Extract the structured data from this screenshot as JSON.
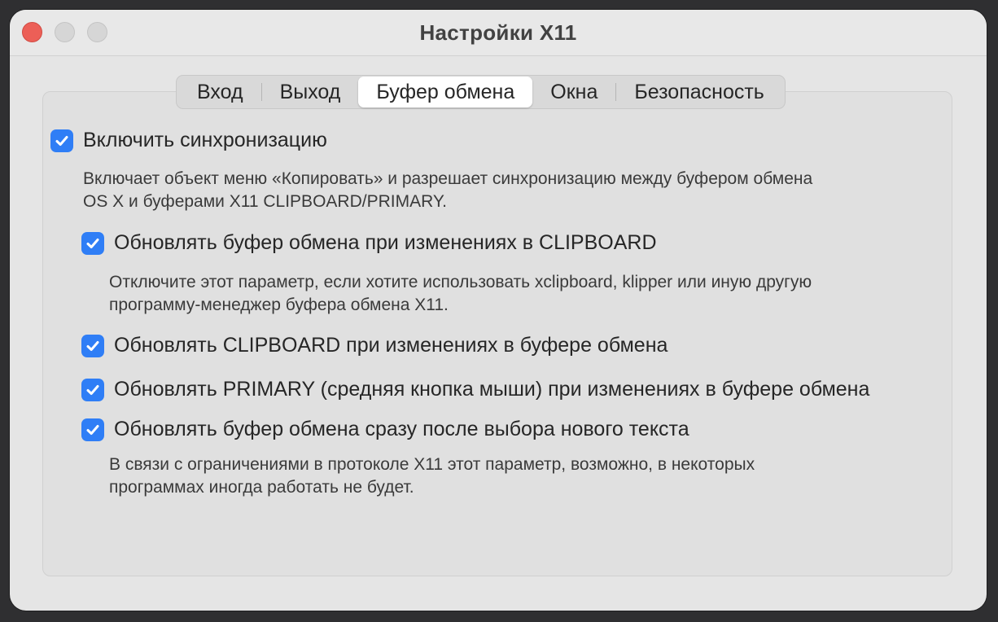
{
  "window": {
    "title": "Настройки X11"
  },
  "tabs": [
    {
      "label": "Вход",
      "active": false
    },
    {
      "label": "Выход",
      "active": false
    },
    {
      "label": "Буфер обмена",
      "active": true
    },
    {
      "label": "Окна",
      "active": false
    },
    {
      "label": "Безопасность",
      "active": false
    }
  ],
  "options": {
    "enable_sync": {
      "label": "Включить синхронизацию",
      "checked": true,
      "description_line1": "Включает объект меню «Копировать» и разрешает синхронизацию между буфером обмена",
      "description_line2": "OS X и буферами X11 CLIPBOARD/PRIMARY."
    },
    "update_pasteboard_on_clipboard": {
      "label": "Обновлять буфер обмена при изменениях в CLIPBOARD",
      "checked": true,
      "description_line1": "Отключите этот параметр, если хотите использовать xclipboard, klipper или иную другую",
      "description_line2": "программу-менеджер буфера обмена X11."
    },
    "update_clipboard_on_pasteboard": {
      "label": "Обновлять CLIPBOARD при изменениях в буфере обмена",
      "checked": true
    },
    "update_primary_on_pasteboard": {
      "label": "Обновлять PRIMARY (средняя кнопка мыши) при изменениях в буфере обмена",
      "checked": true
    },
    "update_pasteboard_on_selection": {
      "label": "Обновлять буфер обмена сразу после выбора нового текста",
      "checked": true,
      "description_line1": "В связи с ограничениями в протоколе X11 этот параметр, возможно, в некоторых",
      "description_line2": "программах иногда работать не будет."
    }
  },
  "colors": {
    "accent": "#2f7ef6",
    "close_button": "#ec5f57",
    "window_background": "#e5e5e5"
  }
}
